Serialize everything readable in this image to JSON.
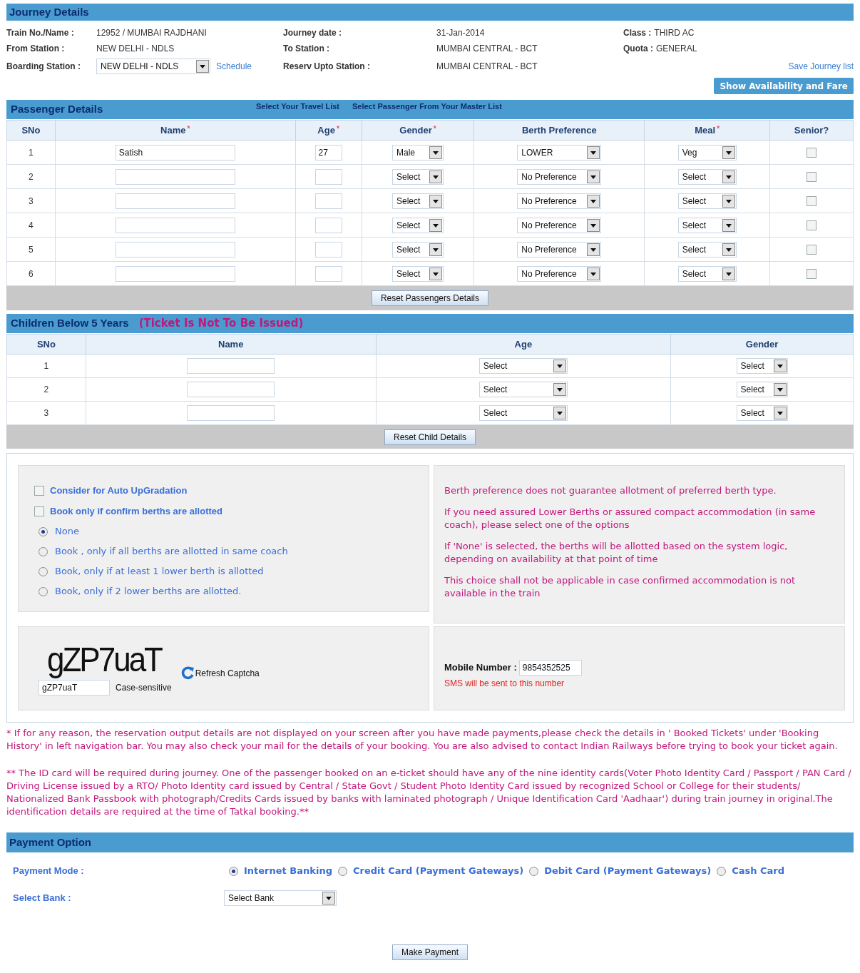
{
  "journey": {
    "title": "Journey Details",
    "rows": [
      [
        {
          "label": "Train No./Name :",
          "value": "12952 / MUMBAI RAJDHANI"
        },
        {
          "label": "Journey date :",
          "value": "31-Jan-2014"
        },
        {
          "label": "Class :",
          "value": "THIRD AC"
        }
      ],
      [
        {
          "label": "From Station :",
          "value": "NEW DELHI - NDLS"
        },
        {
          "label": "To Station :",
          "value": "MUMBAI CENTRAL - BCT"
        },
        {
          "label": "Quota :",
          "value": "GENERAL"
        }
      ]
    ],
    "boarding": {
      "label": "Boarding Station :",
      "value": "NEW DELHI - NDLS",
      "link": "Schedule"
    },
    "upto": {
      "label": "Reserv Upto Station :",
      "value": "MUMBAI CENTRAL - BCT"
    },
    "save_link": "Save Journey list",
    "button": "Show Availability and Fare"
  },
  "passengers": {
    "title": "Passenger Details",
    "links": [
      "Select Your Travel List",
      "Select Passenger From Your Master List"
    ],
    "columns": [
      {
        "label": "SNo"
      },
      {
        "label": "Name",
        "marker": "*"
      },
      {
        "label": "Age",
        "marker": "*"
      },
      {
        "label": "Gender",
        "marker": "*"
      },
      {
        "label": "Berth Preference"
      },
      {
        "label": "Meal",
        "marker": "*"
      },
      {
        "label": "Senior?"
      }
    ],
    "rows": [
      {
        "sno": "1",
        "name": "Satish",
        "age": "27",
        "gender": "Male",
        "berth": "LOWER",
        "meal": "Veg",
        "senior": false
      },
      {
        "sno": "2",
        "gender": "Select",
        "berth": "No Preference",
        "meal": "Select",
        "senior": false
      },
      {
        "sno": "3",
        "gender": "Select",
        "berth": "No Preference",
        "meal": "Select",
        "senior": false
      },
      {
        "sno": "4",
        "gender": "Select",
        "berth": "No Preference",
        "meal": "Select",
        "senior": false
      },
      {
        "sno": "5",
        "gender": "Select",
        "berth": "No Preference",
        "meal": "Select",
        "senior": false
      },
      {
        "sno": "6",
        "gender": "Select",
        "berth": "No Preference",
        "meal": "Select",
        "senior": false
      }
    ],
    "reset": "Reset Passengers Details"
  },
  "children": {
    "title": "Children Below 5 Years",
    "note": "(Ticket Is Not To Be Issued)",
    "columns": [
      "SNo",
      "Name",
      "Age",
      "Gender"
    ],
    "rows": [
      {
        "sno": "1",
        "age": "Select",
        "gender": "Select"
      },
      {
        "sno": "2",
        "age": "Select",
        "gender": "Select"
      },
      {
        "sno": "3",
        "age": "Select",
        "gender": "Select"
      }
    ],
    "reset": "Reset Child Details"
  },
  "options": {
    "checkboxes": [
      {
        "label": "Consider for Auto UpGradation",
        "checked": false
      },
      {
        "label": "Book only if confirm berths are allotted",
        "checked": false
      }
    ],
    "radios": [
      {
        "label": "None",
        "selected": true
      },
      {
        "label": "Book , only if all berths are allotted in same coach",
        "selected": false
      },
      {
        "label": "Book, only if at least 1 lower berth is allotted",
        "selected": false
      },
      {
        "label": "Book, only if 2 lower berths are allotted.",
        "selected": false
      }
    ],
    "info": [
      "Berth preference does not guarantee allotment of preferred berth type.",
      "If you need assured Lower Berths or assured compact accommodation (in same coach), please select one of the options",
      "If 'None' is selected, the berths will be allotted based on the system logic, depending on availability at that point of time",
      "This choice shall not be applicable in case confirmed accommodation is not available in the train"
    ]
  },
  "captcha": {
    "image_text": "gZP7uaT",
    "value": "gZP7uaT",
    "hint": "Case-sensitive",
    "refresh": "Refresh Captcha"
  },
  "mobile": {
    "label": "Mobile Number :",
    "value": "9854352525",
    "note": "SMS will be sent to this number"
  },
  "footnotes": [
    "* If for any reason, the reservation output details are not displayed on your screen after you have made payments,please check the details in ' Booked Tickets' under 'Booking History' in left navigation bar. You may also check your mail for the details of your booking. You are also advised to contact Indian Railways before trying to book your ticket again.",
    "** The ID card will be required during journey. One of the passenger booked on an e-ticket should have any of the nine identity cards(Voter Photo Identity Card / Passport / PAN Card / Driving License issued by a RTO/ Photo Identity card issued by Central / State Govt / Student Photo Identity Card issued by recognized School or College for their students/ Nationalized Bank Passbook with photograph/Credits Cards issued by banks with laminated photograph / Unique Identification Card 'Aadhaar') during train journey in original.The identification details are required at the time of Tatkal booking.**"
  ],
  "payment": {
    "title": "Payment Option",
    "mode_label": "Payment Mode :",
    "modes": [
      {
        "label": "Internet Banking",
        "selected": true
      },
      {
        "label": "Credit Card (Payment Gateways)",
        "selected": false
      },
      {
        "label": "Debit Card (Payment Gateways)",
        "selected": false
      },
      {
        "label": "Cash Card",
        "selected": false
      }
    ],
    "bank_label": "Select Bank :",
    "bank_value": "Select Bank",
    "button": "Make Payment"
  }
}
